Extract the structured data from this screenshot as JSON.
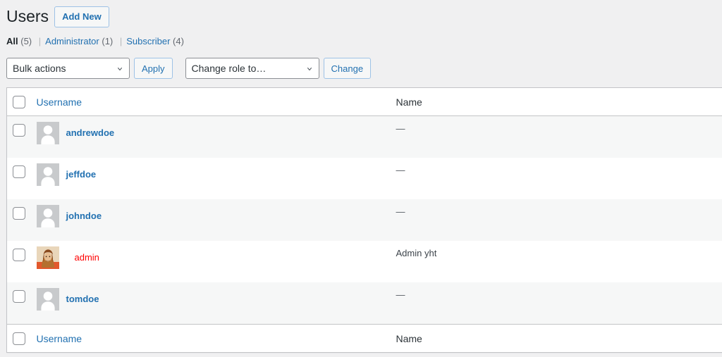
{
  "header": {
    "title": "Users",
    "add_new_label": "Add New"
  },
  "filters": {
    "items": [
      {
        "label": "All",
        "count": "(5)",
        "current": true
      },
      {
        "label": "Administrator",
        "count": "(1)",
        "current": false
      },
      {
        "label": "Subscriber",
        "count": "(4)",
        "current": false
      }
    ],
    "separator": "|"
  },
  "tablenav": {
    "bulk_actions_selected": "Bulk actions",
    "apply_label": "Apply",
    "change_role_selected": "Change role to…",
    "change_label": "Change"
  },
  "table": {
    "columns": {
      "username": "Username",
      "name": "Name"
    },
    "rows": [
      {
        "username": "andrewdoe",
        "name": "—",
        "avatar": "placeholder-avatar-icon",
        "alternate": true,
        "highlight": false
      },
      {
        "username": "jeffdoe",
        "name": "—",
        "avatar": "placeholder-avatar-icon",
        "alternate": false,
        "highlight": false
      },
      {
        "username": "johndoe",
        "name": "—",
        "avatar": "placeholder-avatar-icon",
        "alternate": true,
        "highlight": false
      },
      {
        "username": "admin",
        "name": "Admin yht",
        "avatar": "photo-avatar",
        "alternate": false,
        "highlight": true
      },
      {
        "username": "tomdoe",
        "name": "—",
        "avatar": "placeholder-avatar-icon",
        "alternate": true,
        "highlight": false
      }
    ]
  },
  "colors": {
    "link": "#2271b1",
    "page_bg": "#f0f0f1",
    "row_alt_bg": "#f6f7f7",
    "highlight_username": "#ff0000",
    "border": "#c3c4c7"
  }
}
